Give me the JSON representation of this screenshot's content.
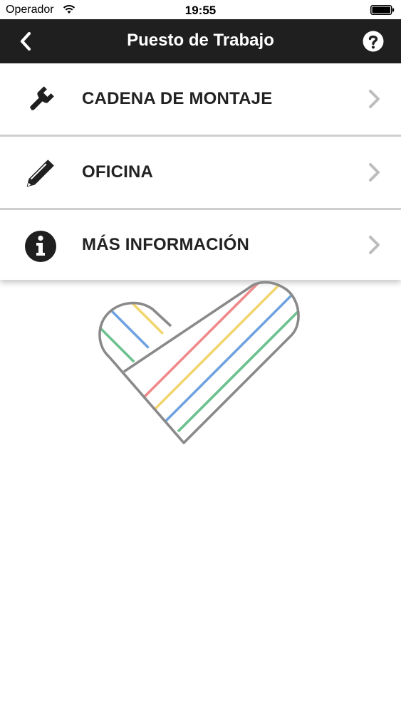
{
  "status_bar": {
    "carrier": "Operador",
    "time": "19:55"
  },
  "nav": {
    "title": "Puesto de Trabajo"
  },
  "menu": {
    "items": [
      {
        "label": "CADENA DE MONTAJE",
        "icon": "wrench-icon"
      },
      {
        "label": "OFICINA",
        "icon": "pencil-icon"
      },
      {
        "label": "MÁS INFORMACIÓN",
        "icon": "info-icon"
      }
    ]
  },
  "colors": {
    "navbar": "#1f1f1f",
    "chevron": "#bdbdbd",
    "heart_outline": "#8a8a8a",
    "stripe_red": "#f08a8a",
    "stripe_yellow": "#f2d56e",
    "stripe_blue": "#6fa3e0",
    "stripe_green": "#6cc08e"
  }
}
